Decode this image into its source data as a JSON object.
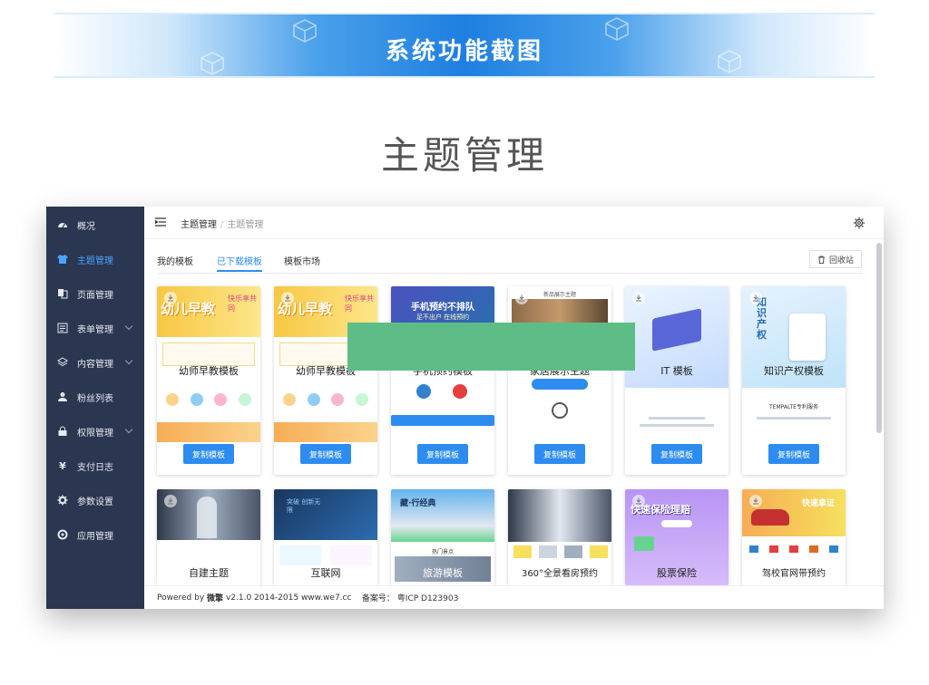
{
  "banner": {
    "title": "系统功能截图"
  },
  "section": {
    "title": "主题管理"
  },
  "sidebar": {
    "items": [
      {
        "label": "概况",
        "icon": "dashboard-icon",
        "active": false,
        "caret": false
      },
      {
        "label": "主题管理",
        "icon": "shirt-icon",
        "active": true,
        "caret": false
      },
      {
        "label": "页面管理",
        "icon": "pages-icon",
        "active": false,
        "caret": false
      },
      {
        "label": "表单管理",
        "icon": "form-icon",
        "active": false,
        "caret": true
      },
      {
        "label": "内容管理",
        "icon": "layers-icon",
        "active": false,
        "caret": true
      },
      {
        "label": "粉丝列表",
        "icon": "user-icon",
        "active": false,
        "caret": false
      },
      {
        "label": "权限管理",
        "icon": "lock-icon",
        "active": false,
        "caret": true
      },
      {
        "label": "支付日志",
        "icon": "yen-icon",
        "active": false,
        "caret": false
      },
      {
        "label": "参数设置",
        "icon": "gear-icon",
        "active": false,
        "caret": false
      },
      {
        "label": "应用管理",
        "icon": "app-icon",
        "active": false,
        "caret": false
      }
    ]
  },
  "breadcrumb": {
    "root": "主题管理",
    "separator": "/",
    "current": "主题管理"
  },
  "tabs": [
    {
      "label": "我的模板",
      "active": false
    },
    {
      "label": "已下载模板",
      "active": true
    },
    {
      "label": "模板市场",
      "active": false
    }
  ],
  "recycle_button": {
    "label": "回收站"
  },
  "copy_label": "复制模板",
  "cards_row1": [
    {
      "name": "幼师早教模板"
    },
    {
      "name": "幼师早教模板"
    },
    {
      "name": "手机预约模板"
    },
    {
      "name": "家居展示主题"
    },
    {
      "name": "IT 模板"
    },
    {
      "name": "知识产权模板"
    }
  ],
  "cards_row2": [
    {
      "name": "自建主题"
    },
    {
      "name": "互联网"
    },
    {
      "name": "旅游模板"
    },
    {
      "name": "360°全景看房预约"
    },
    {
      "name": "股票保险"
    },
    {
      "name": "驾校官网带预约"
    }
  ],
  "card_art_text": {
    "edu_title": "幼儿早教",
    "edu_sub": "快乐享共同",
    "phone_title": "手机预约不排队",
    "phone_sub": "足不出户 在线预约",
    "home_title": "新品展示主题",
    "ip_title": "知识产权",
    "ip_sub": "TEMPALTE专利服务",
    "net_title": "突破 创新无限",
    "travel_title": "藏·行经典",
    "travel_sub": "热门景点",
    "stock_title": "快速保险理赔",
    "drive_title": "快速拿证"
  },
  "footer": {
    "powered_prefix": "Powered by",
    "brand": "微擎",
    "version_text": "v2.1.0 2014-2015 www.we7.cc",
    "icp_label": "备案号：",
    "icp_value": "粤ICP D123903"
  },
  "colors": {
    "accent": "#2d8cf0",
    "sidebar_bg": "#2b3650",
    "green_block": "#5ebd86"
  }
}
